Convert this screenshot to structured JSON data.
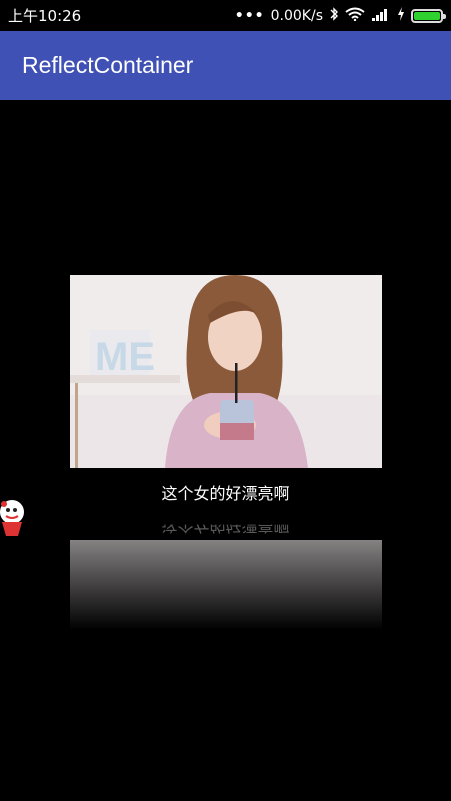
{
  "status_bar": {
    "time": "上午10:26",
    "network_speed": "0.00K/s",
    "icons": [
      "more-dots-icon",
      "bluetooth-icon",
      "wifi-icon",
      "signal-icon",
      "charging-icon",
      "battery-icon"
    ],
    "battery_color": "#2fd12f"
  },
  "app_bar": {
    "title": "ReflectContainer",
    "color": "#3f51b5"
  },
  "content": {
    "caption": "这个女的好漂亮啊",
    "background": "#000000"
  }
}
